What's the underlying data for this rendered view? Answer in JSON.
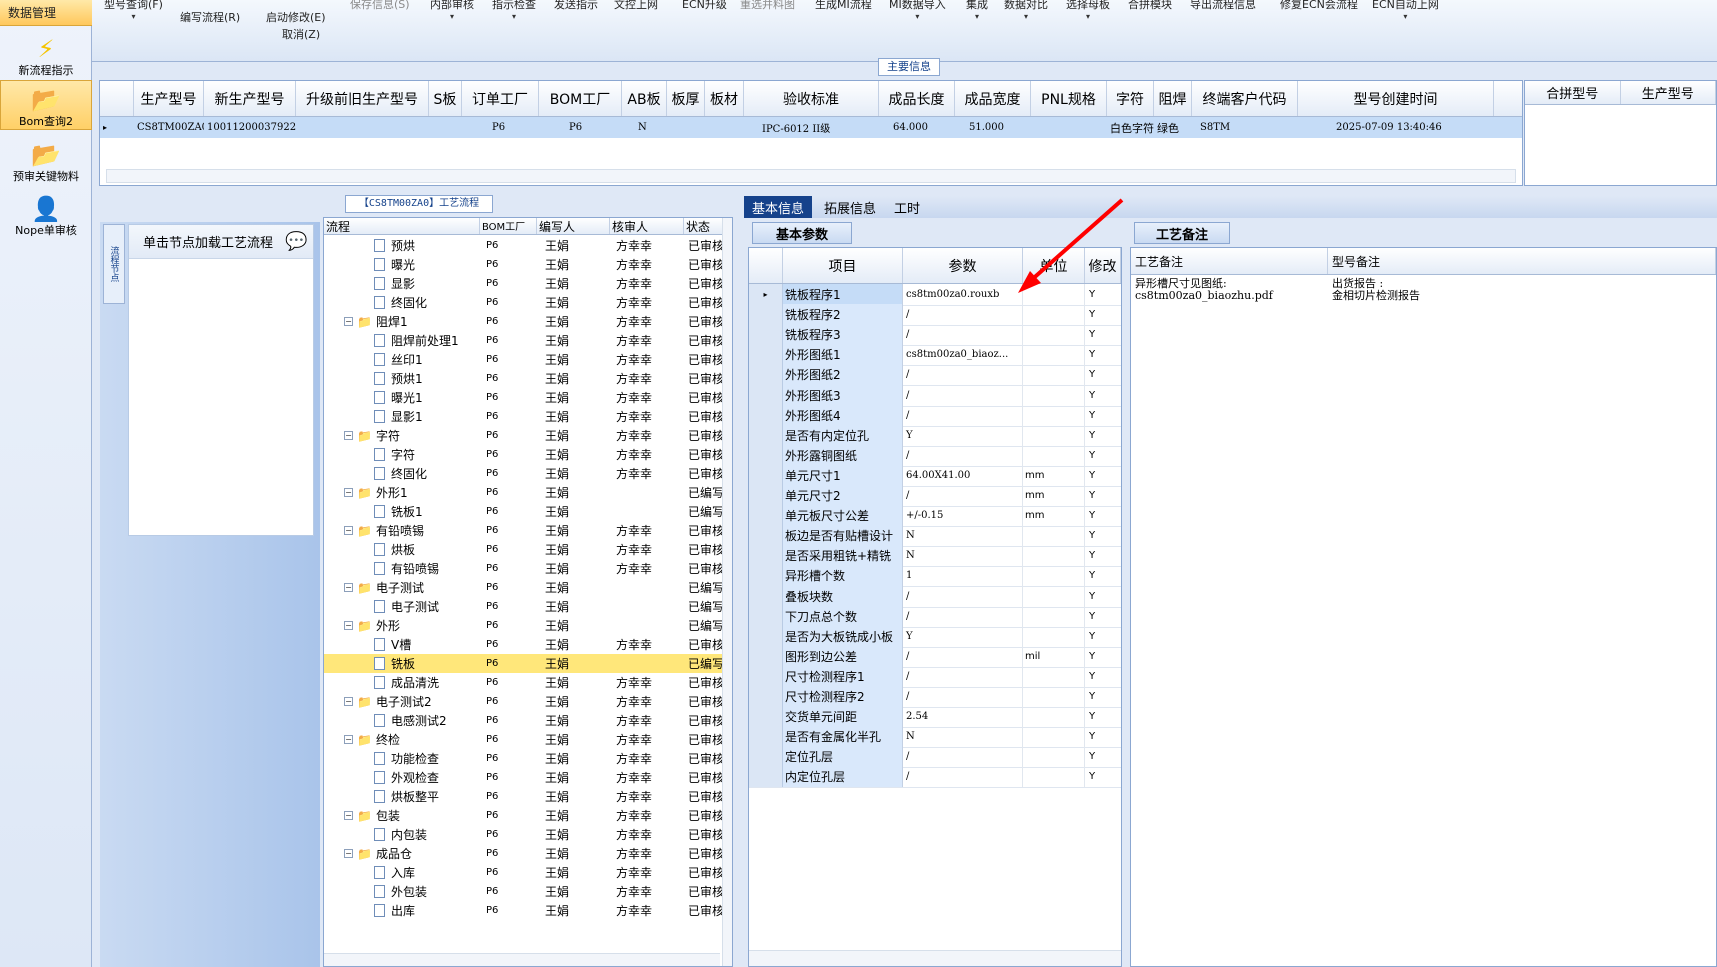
{
  "nav": {
    "title": "数据管理",
    "items": [
      {
        "label": "新流程指示",
        "icon": "lightning-icon"
      },
      {
        "label": "Bom查询2",
        "icon": "folder-icon"
      },
      {
        "label": "预审关键物料",
        "icon": "folder-icon"
      },
      {
        "label": "Nope单审核",
        "icon": "user-icon"
      }
    ]
  },
  "toolbar": {
    "items": [
      "型号查询(F)",
      "编写流程(R)",
      "启动修改(E)",
      "取消(Z)",
      "保存信息(S)",
      "内部审核",
      "指示检查",
      "发送指示",
      "文控上网",
      "ECN升级",
      "重选并料图",
      "生成MI流程",
      "MI数据导入",
      "集成",
      "数据对比",
      "选择母板",
      "合拼模块",
      "导出流程信息",
      "修复ECN会流程",
      "ECN自动上网"
    ]
  },
  "main_info": {
    "label": "主要信息",
    "columns": [
      "生产型号",
      "新生产型号",
      "升级前旧生产型号",
      "S板",
      "订单工厂",
      "BOM工厂",
      "AB板",
      "板厚",
      "板材",
      "验收标准",
      "成品长度",
      "成品宽度",
      "PNL规格",
      "字符",
      "阻焊",
      "终端客户代码",
      "型号创建时间"
    ],
    "row": [
      "CS8TM00ZA0",
      "10011200037922",
      "",
      "",
      "P6",
      "P6",
      "N",
      "",
      "",
      "IPC-6012 II级",
      "64.000",
      "51.000",
      "",
      "白色字符",
      "绿色",
      "S8TM",
      "2025-07-09 13:40:46"
    ],
    "side_columns": [
      "合拼型号",
      "生产型号"
    ]
  },
  "flow": {
    "tab_label": "【CS8TM00ZA0】工艺流程",
    "hint": "单击节点加载工艺流程",
    "side_tab": "流程节点",
    "columns": [
      "流程",
      "BOM工厂",
      "编写人",
      "核审人",
      "状态"
    ],
    "rows": [
      {
        "name": "预烘",
        "level": 2,
        "type": "doc",
        "bom": "P6",
        "writer": "王娟",
        "reviewer": "方幸幸",
        "status": "已审核"
      },
      {
        "name": "曝光",
        "level": 2,
        "type": "doc",
        "bom": "P6",
        "writer": "王娟",
        "reviewer": "方幸幸",
        "status": "已审核"
      },
      {
        "name": "显影",
        "level": 2,
        "type": "doc",
        "bom": "P6",
        "writer": "王娟",
        "reviewer": "方幸幸",
        "status": "已审核"
      },
      {
        "name": "终固化",
        "level": 2,
        "type": "doc",
        "bom": "P6",
        "writer": "王娟",
        "reviewer": "方幸幸",
        "status": "已审核"
      },
      {
        "name": "阻焊1",
        "level": 1,
        "type": "folder",
        "bom": "P6",
        "writer": "王娟",
        "reviewer": "方幸幸",
        "status": "已审核"
      },
      {
        "name": "阻焊前处理1",
        "level": 2,
        "type": "doc",
        "bom": "P6",
        "writer": "王娟",
        "reviewer": "方幸幸",
        "status": "已审核"
      },
      {
        "name": "丝印1",
        "level": 2,
        "type": "doc",
        "bom": "P6",
        "writer": "王娟",
        "reviewer": "方幸幸",
        "status": "已审核"
      },
      {
        "name": "预烘1",
        "level": 2,
        "type": "doc",
        "bom": "P6",
        "writer": "王娟",
        "reviewer": "方幸幸",
        "status": "已审核"
      },
      {
        "name": "曝光1",
        "level": 2,
        "type": "doc",
        "bom": "P6",
        "writer": "王娟",
        "reviewer": "方幸幸",
        "status": "已审核"
      },
      {
        "name": "显影1",
        "level": 2,
        "type": "doc",
        "bom": "P6",
        "writer": "王娟",
        "reviewer": "方幸幸",
        "status": "已审核"
      },
      {
        "name": "字符",
        "level": 1,
        "type": "folder",
        "bom": "P6",
        "writer": "王娟",
        "reviewer": "方幸幸",
        "status": "已审核"
      },
      {
        "name": "字符",
        "level": 2,
        "type": "doc",
        "bom": "P6",
        "writer": "王娟",
        "reviewer": "方幸幸",
        "status": "已审核"
      },
      {
        "name": "终固化",
        "level": 2,
        "type": "doc",
        "bom": "P6",
        "writer": "王娟",
        "reviewer": "方幸幸",
        "status": "已审核"
      },
      {
        "name": "外形1",
        "level": 1,
        "type": "folder",
        "bom": "P6",
        "writer": "王娟",
        "reviewer": "",
        "status": "已编写"
      },
      {
        "name": "铣板1",
        "level": 2,
        "type": "doc",
        "bom": "P6",
        "writer": "王娟",
        "reviewer": "",
        "status": "已编写"
      },
      {
        "name": "有铅喷锡",
        "level": 1,
        "type": "folder",
        "bom": "P6",
        "writer": "王娟",
        "reviewer": "方幸幸",
        "status": "已审核"
      },
      {
        "name": "烘板",
        "level": 2,
        "type": "doc",
        "bom": "P6",
        "writer": "王娟",
        "reviewer": "方幸幸",
        "status": "已审核"
      },
      {
        "name": "有铅喷锡",
        "level": 2,
        "type": "doc",
        "bom": "P6",
        "writer": "王娟",
        "reviewer": "方幸幸",
        "status": "已审核"
      },
      {
        "name": "电子测试",
        "level": 1,
        "type": "folder",
        "bom": "P6",
        "writer": "王娟",
        "reviewer": "",
        "status": "已编写"
      },
      {
        "name": "电子测试",
        "level": 2,
        "type": "doc",
        "bom": "P6",
        "writer": "王娟",
        "reviewer": "",
        "status": "已编写"
      },
      {
        "name": "外形",
        "level": 1,
        "type": "folder",
        "bom": "P6",
        "writer": "王娟",
        "reviewer": "",
        "status": "已编写"
      },
      {
        "name": "V槽",
        "level": 2,
        "type": "doc",
        "bom": "P6",
        "writer": "王娟",
        "reviewer": "方幸幸",
        "status": "已审核"
      },
      {
        "name": "铣板",
        "level": 2,
        "type": "doc",
        "bom": "P6",
        "writer": "王娟",
        "reviewer": "",
        "status": "已编写",
        "selected": true
      },
      {
        "name": "成品清洗",
        "level": 2,
        "type": "doc",
        "bom": "P6",
        "writer": "王娟",
        "reviewer": "方幸幸",
        "status": "已审核"
      },
      {
        "name": "电子测试2",
        "level": 1,
        "type": "folder",
        "bom": "P6",
        "writer": "王娟",
        "reviewer": "方幸幸",
        "status": "已审核"
      },
      {
        "name": "电感测试2",
        "level": 2,
        "type": "doc",
        "bom": "P6",
        "writer": "王娟",
        "reviewer": "方幸幸",
        "status": "已审核"
      },
      {
        "name": "终检",
        "level": 1,
        "type": "folder",
        "bom": "P6",
        "writer": "王娟",
        "reviewer": "方幸幸",
        "status": "已审核"
      },
      {
        "name": "功能检查",
        "level": 2,
        "type": "doc",
        "bom": "P6",
        "writer": "王娟",
        "reviewer": "方幸幸",
        "status": "已审核"
      },
      {
        "name": "外观检查",
        "level": 2,
        "type": "doc",
        "bom": "P6",
        "writer": "王娟",
        "reviewer": "方幸幸",
        "status": "已审核"
      },
      {
        "name": "烘板整平",
        "level": 2,
        "type": "doc",
        "bom": "P6",
        "writer": "王娟",
        "reviewer": "方幸幸",
        "status": "已审核"
      },
      {
        "name": "包装",
        "level": 1,
        "type": "folder",
        "bom": "P6",
        "writer": "王娟",
        "reviewer": "方幸幸",
        "status": "已审核"
      },
      {
        "name": "内包装",
        "level": 2,
        "type": "doc",
        "bom": "P6",
        "writer": "王娟",
        "reviewer": "方幸幸",
        "status": "已审核"
      },
      {
        "name": "成品仓",
        "level": 1,
        "type": "folder",
        "bom": "P6",
        "writer": "王娟",
        "reviewer": "方幸幸",
        "status": "已审核"
      },
      {
        "name": "入库",
        "level": 2,
        "type": "doc",
        "bom": "P6",
        "writer": "王娟",
        "reviewer": "方幸幸",
        "status": "已审核"
      },
      {
        "name": "外包装",
        "level": 2,
        "type": "doc",
        "bom": "P6",
        "writer": "王娟",
        "reviewer": "方幸幸",
        "status": "已审核"
      },
      {
        "name": "出库",
        "level": 2,
        "type": "doc",
        "bom": "P6",
        "writer": "王娟",
        "reviewer": "方幸幸",
        "status": "已审核"
      }
    ]
  },
  "detail_tabs": [
    "基本信息",
    "拓展信息",
    "工时"
  ],
  "params": {
    "title": "基本参数",
    "columns": [
      "项目",
      "参数",
      "单位",
      "修改"
    ],
    "rows": [
      [
        "铣板程序1",
        "cs8tm00za0.rouxb",
        "",
        "Y"
      ],
      [
        "铣板程序2",
        "/",
        "",
        "Y"
      ],
      [
        "铣板程序3",
        "/",
        "",
        "Y"
      ],
      [
        "外形图纸1",
        "cs8tm00za0_biaoz...",
        "",
        "Y"
      ],
      [
        "外形图纸2",
        "/",
        "",
        "Y"
      ],
      [
        "外形图纸3",
        "/",
        "",
        "Y"
      ],
      [
        "外形图纸4",
        "/",
        "",
        "Y"
      ],
      [
        "是否有内定位孔",
        "Y",
        "",
        "Y"
      ],
      [
        "外形露铜图纸",
        "/",
        "",
        "Y"
      ],
      [
        "单元尺寸1",
        "64.00X41.00",
        "mm",
        "Y"
      ],
      [
        "单元尺寸2",
        "/",
        "mm",
        "Y"
      ],
      [
        "单元板尺寸公差",
        "+/-0.15",
        "mm",
        "Y"
      ],
      [
        "板边是否有贴槽设计",
        "N",
        "",
        "Y"
      ],
      [
        "是否采用粗铣+精铣",
        "N",
        "",
        "Y"
      ],
      [
        "异形槽个数",
        "1",
        "",
        "Y"
      ],
      [
        "叠板块数",
        "/",
        "",
        "Y"
      ],
      [
        "下刀点总个数",
        "/",
        "",
        "Y"
      ],
      [
        "是否为大板铣成小板",
        "Y",
        "",
        "Y"
      ],
      [
        "图形到边公差",
        "/",
        "mil",
        "Y"
      ],
      [
        "尺寸检测程序1",
        "/",
        "",
        "Y"
      ],
      [
        "尺寸检测程序2",
        "/",
        "",
        "Y"
      ],
      [
        "交货单元间距",
        "2.54",
        "",
        "Y"
      ],
      [
        "是否有金属化半孔",
        "N",
        "",
        "Y"
      ],
      [
        "定位孔层",
        "/",
        "",
        "Y"
      ],
      [
        "内定位孔层",
        "/",
        "",
        "Y"
      ]
    ]
  },
  "notes": {
    "title": "工艺备注",
    "columns": [
      "工艺备注",
      "型号备注"
    ],
    "craft_note": "异形槽尺寸见图纸:\ncs8tm00za0_biaozhu.pdf",
    "model_note": "出货报告 :\n金相切片检测报告"
  },
  "colors": {
    "accent": "#15428b",
    "selection": "#ffe77a",
    "header_bg": "#dfe8f6",
    "arrow": "#ff0000"
  }
}
